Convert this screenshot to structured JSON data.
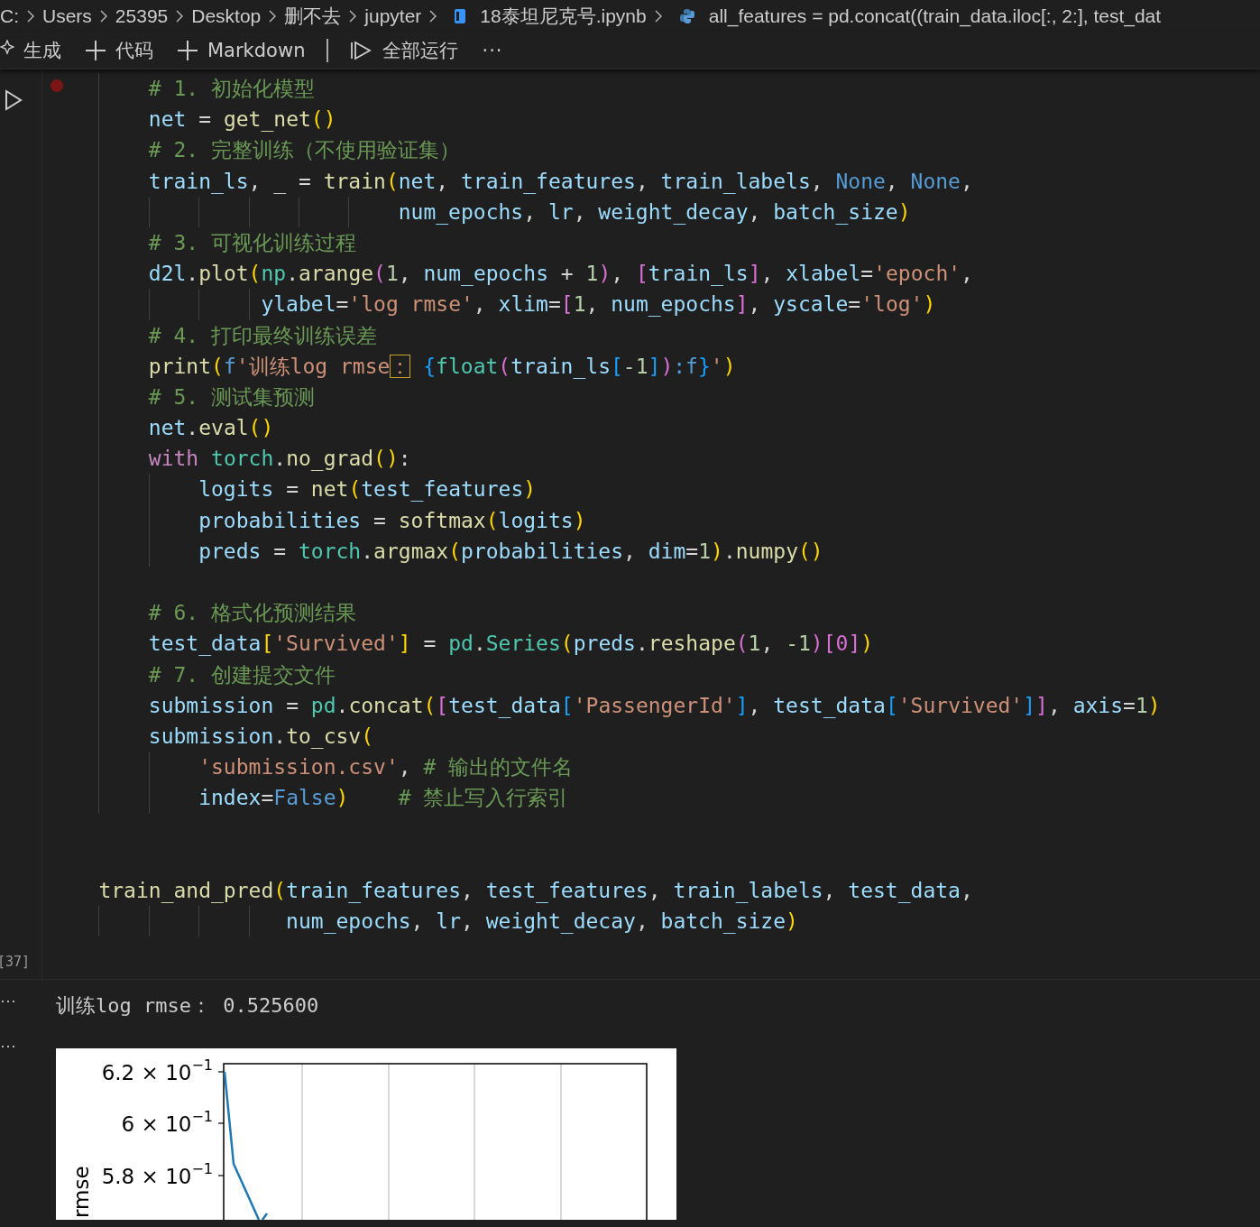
{
  "breadcrumbs": [
    {
      "kind": "folder",
      "text": "C:"
    },
    {
      "kind": "folder",
      "text": "Users"
    },
    {
      "kind": "folder",
      "text": "25395"
    },
    {
      "kind": "folder",
      "text": "Desktop"
    },
    {
      "kind": "folder",
      "text": "删不去"
    },
    {
      "kind": "folder",
      "text": "jupyter"
    },
    {
      "kind": "notebook",
      "text": "18泰坦尼克号.ipynb"
    },
    {
      "kind": "python",
      "text": "all_features = pd.concat((train_data.iloc[:, 2:], test_dat"
    }
  ],
  "toolbar": [
    {
      "kind": "sparkle",
      "text": "生成"
    },
    {
      "kind": "plus",
      "text": "代码"
    },
    {
      "kind": "plus",
      "text": "Markdown"
    },
    {
      "kind": "divider"
    },
    {
      "kind": "run",
      "text": "全部运行"
    },
    {
      "kind": "more",
      "text": "···"
    }
  ],
  "cell": {
    "breakpoint": true,
    "execution_count": "[37]",
    "lines": [
      {
        "kind": "code",
        "tokens": [
          {
            "kind": "c",
            "text": "        # 1. 初始化模型"
          }
        ]
      },
      {
        "kind": "code",
        "tokens": [
          {
            "kind": "v",
            "text": "        net"
          },
          {
            "kind": "p",
            "text": " = "
          },
          {
            "kind": "f",
            "text": "get_net"
          },
          {
            "kind": "y",
            "text": "()"
          }
        ]
      },
      {
        "kind": "code",
        "tokens": [
          {
            "kind": "c",
            "text": "        # 2. 完整训练（不使用验证集）"
          }
        ]
      },
      {
        "kind": "code",
        "tokens": [
          {
            "kind": "v",
            "text": "        train_ls"
          },
          {
            "kind": "p",
            "text": ", _ = "
          },
          {
            "kind": "f",
            "text": "train"
          },
          {
            "kind": "y",
            "text": "("
          },
          {
            "kind": "v",
            "text": "net"
          },
          {
            "kind": "p",
            "text": ", "
          },
          {
            "kind": "v",
            "text": "train_features"
          },
          {
            "kind": "p",
            "text": ", "
          },
          {
            "kind": "v",
            "text": "train_labels"
          },
          {
            "kind": "p",
            "text": ", "
          },
          {
            "kind": "b",
            "text": "None"
          },
          {
            "kind": "p",
            "text": ", "
          },
          {
            "kind": "b",
            "text": "None"
          },
          {
            "kind": "p",
            "text": ","
          }
        ]
      },
      {
        "kind": "code",
        "tokens": [
          {
            "kind": "v",
            "text": "                            num_epochs"
          },
          {
            "kind": "p",
            "text": ", "
          },
          {
            "kind": "v",
            "text": "lr"
          },
          {
            "kind": "p",
            "text": ", "
          },
          {
            "kind": "v",
            "text": "weight_decay"
          },
          {
            "kind": "p",
            "text": ", "
          },
          {
            "kind": "v",
            "text": "batch_size"
          },
          {
            "kind": "y",
            "text": ")"
          }
        ]
      },
      {
        "kind": "code",
        "tokens": [
          {
            "kind": "c",
            "text": "        # 3. 可视化训练过程"
          }
        ]
      },
      {
        "kind": "code",
        "tokens": [
          {
            "kind": "v",
            "text": "        d2l"
          },
          {
            "kind": "p",
            "text": "."
          },
          {
            "kind": "f",
            "text": "plot"
          },
          {
            "kind": "y",
            "text": "("
          },
          {
            "kind": "m",
            "text": "np"
          },
          {
            "kind": "p",
            "text": "."
          },
          {
            "kind": "f",
            "text": "arange"
          },
          {
            "kind": "pk",
            "text": "("
          },
          {
            "kind": "n",
            "text": "1"
          },
          {
            "kind": "p",
            "text": ", "
          },
          {
            "kind": "v",
            "text": "num_epochs"
          },
          {
            "kind": "p",
            "text": " + "
          },
          {
            "kind": "n",
            "text": "1"
          },
          {
            "kind": "pk",
            "text": ")"
          },
          {
            "kind": "p",
            "text": ", "
          },
          {
            "kind": "pk",
            "text": "["
          },
          {
            "kind": "v",
            "text": "train_ls"
          },
          {
            "kind": "pk",
            "text": "]"
          },
          {
            "kind": "p",
            "text": ", "
          },
          {
            "kind": "v",
            "text": "xlabel"
          },
          {
            "kind": "p",
            "text": "="
          },
          {
            "kind": "s",
            "text": "'epoch'"
          },
          {
            "kind": "p",
            "text": ","
          }
        ]
      },
      {
        "kind": "code",
        "tokens": [
          {
            "kind": "v",
            "text": "                 ylabel"
          },
          {
            "kind": "p",
            "text": "="
          },
          {
            "kind": "s",
            "text": "'log rmse'"
          },
          {
            "kind": "p",
            "text": ", "
          },
          {
            "kind": "v",
            "text": "xlim"
          },
          {
            "kind": "p",
            "text": "="
          },
          {
            "kind": "pk",
            "text": "["
          },
          {
            "kind": "n",
            "text": "1"
          },
          {
            "kind": "p",
            "text": ", "
          },
          {
            "kind": "v",
            "text": "num_epochs"
          },
          {
            "kind": "pk",
            "text": "]"
          },
          {
            "kind": "p",
            "text": ", "
          },
          {
            "kind": "v",
            "text": "yscale"
          },
          {
            "kind": "p",
            "text": "="
          },
          {
            "kind": "s",
            "text": "'log'"
          },
          {
            "kind": "y",
            "text": ")"
          }
        ]
      },
      {
        "kind": "code",
        "tokens": [
          {
            "kind": "c",
            "text": "        # 4. 打印最终训练误差"
          }
        ]
      },
      {
        "kind": "code",
        "tokens": [
          {
            "kind": "f",
            "text": "        print"
          },
          {
            "kind": "y",
            "text": "("
          },
          {
            "kind": "b",
            "text": "f"
          },
          {
            "kind": "s",
            "text": "'训练log rmse"
          },
          {
            "kind": "flag",
            "text": "："
          },
          {
            "kind": "bl",
            "text": " {"
          },
          {
            "kind": "m",
            "text": "float"
          },
          {
            "kind": "pk",
            "text": "("
          },
          {
            "kind": "v",
            "text": "train_ls"
          },
          {
            "kind": "bl",
            "text": "["
          },
          {
            "kind": "n",
            "text": "-1"
          },
          {
            "kind": "bl",
            "text": "]"
          },
          {
            "kind": "pk",
            "text": ")"
          },
          {
            "kind": "b",
            "text": ":f"
          },
          {
            "kind": "bl",
            "text": "}"
          },
          {
            "kind": "s",
            "text": "'"
          },
          {
            "kind": "y",
            "text": ")"
          }
        ]
      },
      {
        "kind": "code",
        "tokens": [
          {
            "kind": "c",
            "text": "        # 5. 测试集预测"
          }
        ]
      },
      {
        "kind": "code",
        "tokens": [
          {
            "kind": "v",
            "text": "        net"
          },
          {
            "kind": "p",
            "text": "."
          },
          {
            "kind": "f",
            "text": "eval"
          },
          {
            "kind": "y",
            "text": "()"
          }
        ]
      },
      {
        "kind": "code",
        "tokens": [
          {
            "kind": "k",
            "text": "        with"
          },
          {
            "kind": "m",
            "text": " torch"
          },
          {
            "kind": "p",
            "text": "."
          },
          {
            "kind": "f",
            "text": "no_grad"
          },
          {
            "kind": "y",
            "text": "()"
          },
          {
            "kind": "p",
            "text": ":"
          }
        ]
      },
      {
        "kind": "code",
        "tokens": [
          {
            "kind": "v",
            "text": "            logits"
          },
          {
            "kind": "p",
            "text": " = "
          },
          {
            "kind": "f",
            "text": "net"
          },
          {
            "kind": "y",
            "text": "("
          },
          {
            "kind": "v",
            "text": "test_features"
          },
          {
            "kind": "y",
            "text": ")"
          }
        ]
      },
      {
        "kind": "code",
        "tokens": [
          {
            "kind": "v",
            "text": "            probabilities"
          },
          {
            "kind": "p",
            "text": " = "
          },
          {
            "kind": "f",
            "text": "softmax"
          },
          {
            "kind": "y",
            "text": "("
          },
          {
            "kind": "v",
            "text": "logits"
          },
          {
            "kind": "y",
            "text": ")"
          }
        ]
      },
      {
        "kind": "code",
        "tokens": [
          {
            "kind": "v",
            "text": "            preds"
          },
          {
            "kind": "p",
            "text": " = "
          },
          {
            "kind": "m",
            "text": "torch"
          },
          {
            "kind": "p",
            "text": "."
          },
          {
            "kind": "f",
            "text": "argmax"
          },
          {
            "kind": "y",
            "text": "("
          },
          {
            "kind": "v",
            "text": "probabilities"
          },
          {
            "kind": "p",
            "text": ", "
          },
          {
            "kind": "v",
            "text": "dim"
          },
          {
            "kind": "p",
            "text": "="
          },
          {
            "kind": "n",
            "text": "1"
          },
          {
            "kind": "y",
            "text": ")"
          },
          {
            "kind": "p",
            "text": "."
          },
          {
            "kind": "f",
            "text": "numpy"
          },
          {
            "kind": "y",
            "text": "()"
          }
        ]
      },
      {
        "kind": "guide"
      },
      {
        "kind": "code",
        "tokens": [
          {
            "kind": "c",
            "text": "        # 6. 格式化预测结果"
          }
        ]
      },
      {
        "kind": "code",
        "tokens": [
          {
            "kind": "v",
            "text": "        test_data"
          },
          {
            "kind": "y",
            "text": "["
          },
          {
            "kind": "s",
            "text": "'Survived'"
          },
          {
            "kind": "y",
            "text": "]"
          },
          {
            "kind": "p",
            "text": " = "
          },
          {
            "kind": "m",
            "text": "pd"
          },
          {
            "kind": "p",
            "text": "."
          },
          {
            "kind": "m",
            "text": "Series"
          },
          {
            "kind": "y",
            "text": "("
          },
          {
            "kind": "v",
            "text": "preds"
          },
          {
            "kind": "p",
            "text": "."
          },
          {
            "kind": "f",
            "text": "reshape"
          },
          {
            "kind": "pk",
            "text": "("
          },
          {
            "kind": "n",
            "text": "1"
          },
          {
            "kind": "p",
            "text": ", "
          },
          {
            "kind": "n",
            "text": "-1"
          },
          {
            "kind": "pk",
            "text": ")[0]"
          },
          {
            "kind": "y",
            "text": ")"
          }
        ]
      },
      {
        "kind": "code",
        "tokens": [
          {
            "kind": "c",
            "text": "        # 7. 创建提交文件"
          }
        ]
      },
      {
        "kind": "code",
        "tokens": [
          {
            "kind": "v",
            "text": "        submission"
          },
          {
            "kind": "p",
            "text": " = "
          },
          {
            "kind": "m",
            "text": "pd"
          },
          {
            "kind": "p",
            "text": "."
          },
          {
            "kind": "f",
            "text": "concat"
          },
          {
            "kind": "y",
            "text": "("
          },
          {
            "kind": "pk",
            "text": "["
          },
          {
            "kind": "v",
            "text": "test_data"
          },
          {
            "kind": "bl",
            "text": "["
          },
          {
            "kind": "s",
            "text": "'PassengerId'"
          },
          {
            "kind": "bl",
            "text": "]"
          },
          {
            "kind": "p",
            "text": ", "
          },
          {
            "kind": "v",
            "text": "test_data"
          },
          {
            "kind": "bl",
            "text": "["
          },
          {
            "kind": "s",
            "text": "'Survived'"
          },
          {
            "kind": "bl",
            "text": "]"
          },
          {
            "kind": "pk",
            "text": "]"
          },
          {
            "kind": "p",
            "text": ", "
          },
          {
            "kind": "v",
            "text": "axis"
          },
          {
            "kind": "p",
            "text": "="
          },
          {
            "kind": "n",
            "text": "1"
          },
          {
            "kind": "y",
            "text": ")"
          }
        ]
      },
      {
        "kind": "code",
        "tokens": [
          {
            "kind": "v",
            "text": "        submission"
          },
          {
            "kind": "p",
            "text": "."
          },
          {
            "kind": "f",
            "text": "to_csv"
          },
          {
            "kind": "y",
            "text": "("
          }
        ]
      },
      {
        "kind": "code",
        "tokens": [
          {
            "kind": "s",
            "text": "            'submission.csv'"
          },
          {
            "kind": "p",
            "text": ", "
          },
          {
            "kind": "c",
            "text": "# 输出的文件名"
          }
        ]
      },
      {
        "kind": "code",
        "tokens": [
          {
            "kind": "v",
            "text": "            index"
          },
          {
            "kind": "p",
            "text": "="
          },
          {
            "kind": "b",
            "text": "False"
          },
          {
            "kind": "y",
            "text": ")"
          },
          {
            "kind": "c",
            "text": "    # 禁止写入行索引"
          }
        ]
      },
      {
        "kind": "blank"
      },
      {
        "kind": "blank"
      },
      {
        "kind": "code",
        "tokens": [
          {
            "kind": "f",
            "text": "    train_and_pred"
          },
          {
            "kind": "y",
            "text": "("
          },
          {
            "kind": "v",
            "text": "train_features"
          },
          {
            "kind": "p",
            "text": ", "
          },
          {
            "kind": "v",
            "text": "test_features"
          },
          {
            "kind": "p",
            "text": ", "
          },
          {
            "kind": "v",
            "text": "train_labels"
          },
          {
            "kind": "p",
            "text": ", "
          },
          {
            "kind": "v",
            "text": "test_data"
          },
          {
            "kind": "p",
            "text": ","
          }
        ]
      },
      {
        "kind": "code",
        "tokens": [
          {
            "kind": "v",
            "text": "                   num_epochs"
          },
          {
            "kind": "p",
            "text": ", "
          },
          {
            "kind": "v",
            "text": "lr"
          },
          {
            "kind": "p",
            "text": ", "
          },
          {
            "kind": "v",
            "text": "weight_decay"
          },
          {
            "kind": "p",
            "text": ", "
          },
          {
            "kind": "v",
            "text": "batch_size"
          },
          {
            "kind": "y",
            "text": ")"
          }
        ]
      }
    ]
  },
  "outputs": [
    {
      "kind": "text",
      "more": "···",
      "text": "训练log rmse： 0.525600"
    },
    {
      "kind": "plot",
      "more": "···",
      "ylabel": "rmse",
      "yticks": [
        {
          "mantissa": "6.2 × 10",
          "exponent": "−1"
        },
        {
          "mantissa": "6 × 10",
          "exponent": "−1"
        },
        {
          "mantissa": "5.8 × 10",
          "exponent": "−1"
        }
      ]
    }
  ]
}
